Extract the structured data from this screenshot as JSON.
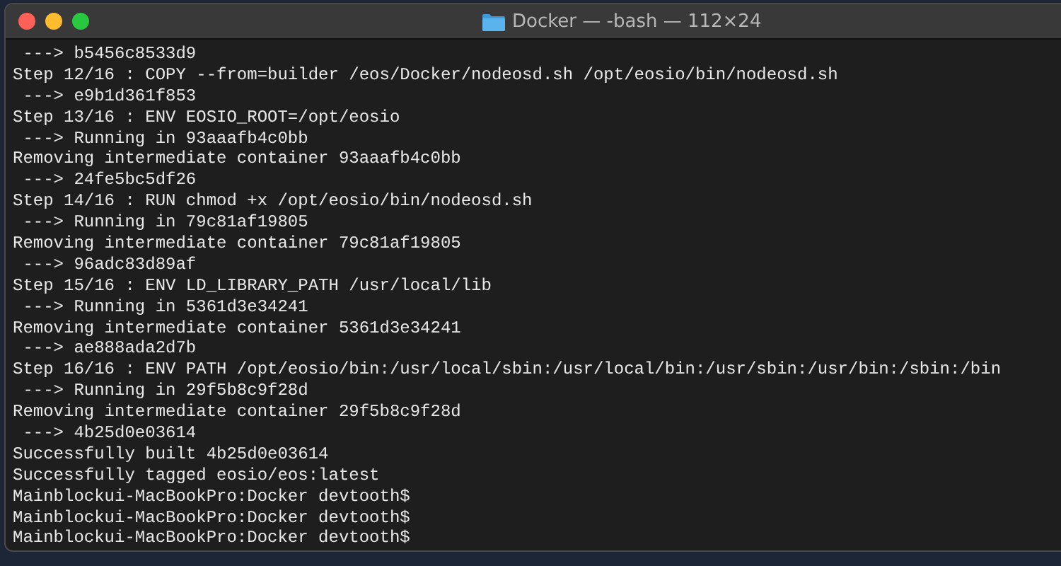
{
  "window": {
    "title": "Docker — -bash — 112×24",
    "buttons": [
      {
        "kind": "close"
      },
      {
        "kind": "minimize"
      },
      {
        "kind": "zoom"
      }
    ]
  },
  "terminal": {
    "lines": [
      " ---> b5456c8533d9",
      "Step 12/16 : COPY --from=builder /eos/Docker/nodeosd.sh /opt/eosio/bin/nodeosd.sh",
      " ---> e9b1d361f853",
      "Step 13/16 : ENV EOSIO_ROOT=/opt/eosio",
      " ---> Running in 93aaafb4c0bb",
      "Removing intermediate container 93aaafb4c0bb",
      " ---> 24fe5bc5df26",
      "Step 14/16 : RUN chmod +x /opt/eosio/bin/nodeosd.sh",
      " ---> Running in 79c81af19805",
      "Removing intermediate container 79c81af19805",
      " ---> 96adc83d89af",
      "Step 15/16 : ENV LD_LIBRARY_PATH /usr/local/lib",
      " ---> Running in 5361d3e34241",
      "Removing intermediate container 5361d3e34241",
      " ---> ae888ada2d7b",
      "Step 16/16 : ENV PATH /opt/eosio/bin:/usr/local/sbin:/usr/local/bin:/usr/sbin:/usr/bin:/sbin:/bin",
      " ---> Running in 29f5b8c9f28d",
      "Removing intermediate container 29f5b8c9f28d",
      " ---> 4b25d0e03614",
      "Successfully built 4b25d0e03614",
      "Successfully tagged eosio/eos:latest",
      "Mainblockui-MacBookPro:Docker devtooth$",
      "Mainblockui-MacBookPro:Docker devtooth$",
      "Mainblockui-MacBookPro:Docker devtooth$"
    ]
  }
}
